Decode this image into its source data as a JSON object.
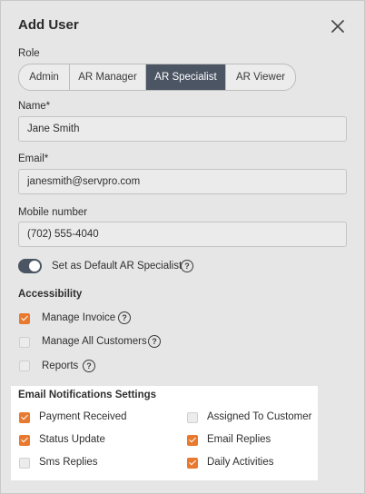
{
  "dialog": {
    "title": "Add User"
  },
  "role": {
    "label": "Role",
    "options": [
      "Admin",
      "AR Manager",
      "AR Specialist",
      "AR Viewer"
    ],
    "selected": "AR Specialist"
  },
  "name": {
    "label": "Name*",
    "value": "Jane Smith"
  },
  "email": {
    "label": "Email*",
    "value": "janesmith@servpro.com"
  },
  "mobile": {
    "label": "Mobile number",
    "value": "(702) 555-4040"
  },
  "default_toggle": {
    "label": "Set as Default AR Specialist",
    "on": true
  },
  "accessibility": {
    "title": "Accessibility",
    "items": [
      {
        "label": "Manage Invoice",
        "checked": true
      },
      {
        "label": "Manage All Customers",
        "checked": false
      },
      {
        "label": "Reports",
        "checked": false
      }
    ]
  },
  "notifications": {
    "title": "Email Notifications Settings",
    "left": [
      {
        "label": "Payment Received",
        "checked": true
      },
      {
        "label": "Status Update",
        "checked": true
      },
      {
        "label": "Sms Replies",
        "checked": false
      }
    ],
    "right": [
      {
        "label": "Assigned To Customer",
        "checked": false
      },
      {
        "label": "Email Replies",
        "checked": true
      },
      {
        "label": "Daily Activities",
        "checked": true
      }
    ]
  },
  "colors": {
    "accent": "#e8792e",
    "selected_segment": "#4b5563",
    "panel_bg": "#e6e6e6"
  },
  "icons": {
    "close": "close-icon",
    "help": "help-icon"
  }
}
